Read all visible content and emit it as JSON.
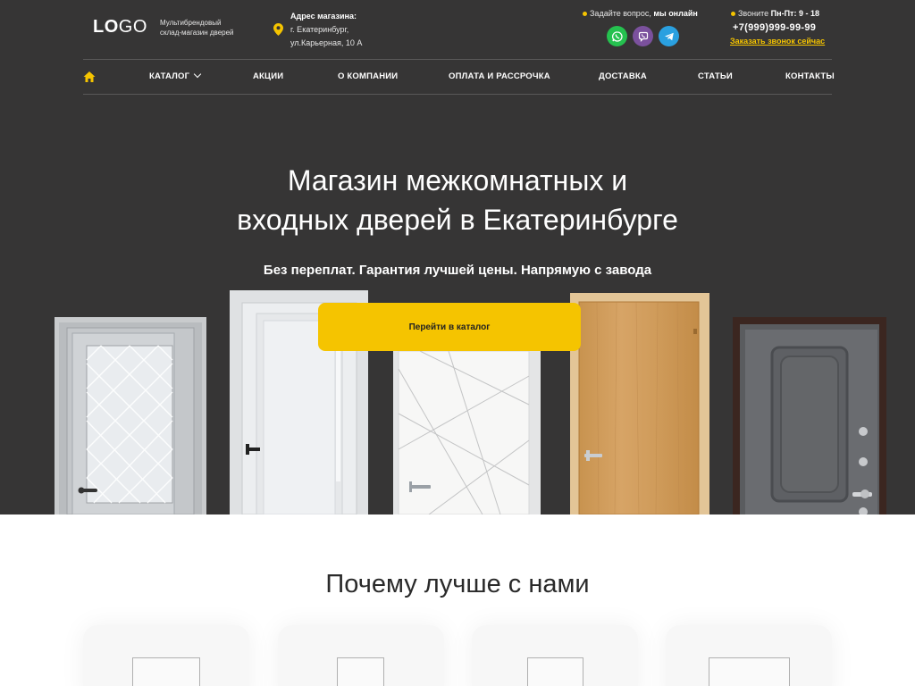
{
  "header": {
    "logo_bold": "LO",
    "logo_rest": "GO",
    "tagline_line1": "Мультибрендовый",
    "tagline_line2": "склад-магазин дверей",
    "address_title": "Адрес магазина:",
    "address_line1": "г. Екатеринбург,",
    "address_line2": "ул.Карьерная, 10 А",
    "ask_text": "Задайте вопрос,",
    "ask_online": "мы онлайн",
    "call_text": "Звоните",
    "call_hours": "Пн-Пт: 9 - 18",
    "phone": "+7(999)999-99-99",
    "callback": "Заказать звонок сейчас",
    "accent": "#f5c400"
  },
  "nav": {
    "items": [
      {
        "label": "КАТАЛОГ"
      },
      {
        "label": "АКЦИИ"
      },
      {
        "label": "О КОМПАНИИ"
      },
      {
        "label": "ОПЛАТА И РАССРОЧКА"
      },
      {
        "label": "ДОСТАВКА"
      },
      {
        "label": "СТАТЬИ"
      },
      {
        "label": "КОНТАКТЫ"
      }
    ]
  },
  "hero": {
    "title_line1": "Магазин межкомнатных и",
    "title_line2": "входных дверей в Екатеринбурге",
    "subtitle": "Без переплат. Гарантия лучшей цены. Напрямую с завода",
    "cta": "Перейти в каталог",
    "background": "#363535"
  },
  "why": {
    "title": "Почему лучше с нами"
  }
}
